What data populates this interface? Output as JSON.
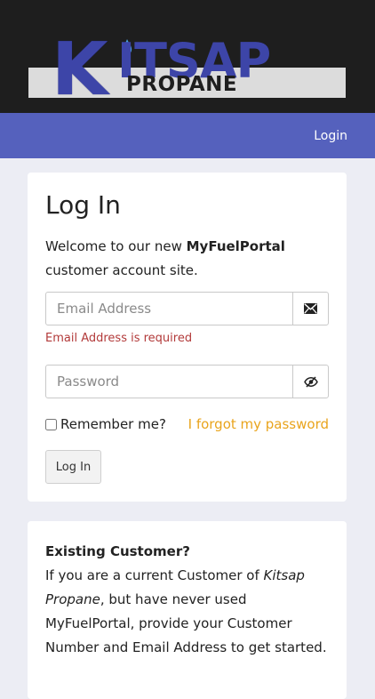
{
  "logo": {
    "brand_k": "K",
    "brand_rest": "ITSAP",
    "brand_sub": "PROPANE",
    "primary_color": "#3d45a8",
    "band_color": "#dcdcdc"
  },
  "navbar": {
    "login_label": "Login",
    "background": "#5561bd"
  },
  "login_card": {
    "title": "Log In",
    "welcome_prefix": "Welcome to our new ",
    "welcome_brand": "MyFuelPortal",
    "welcome_suffix": " customer account site.",
    "email": {
      "placeholder": "Email Address",
      "value": "",
      "icon": "envelope-icon",
      "error": "Email Address is required"
    },
    "password": {
      "placeholder": "Password",
      "value": "",
      "icon": "eye-slash-icon"
    },
    "remember_label": "Remember me?",
    "remember_checked": false,
    "forgot_label": "I forgot my password",
    "submit_label": "Log In",
    "error_color": "#b23a3a",
    "link_color": "#e9a41c"
  },
  "existing_card": {
    "title": "Existing Customer?",
    "text_1": "If you are a current Customer of ",
    "company": "Kitsap Propane",
    "text_2": ", but have never used MyFuelPortal, provide your Customer Number and Email Address to get started."
  }
}
